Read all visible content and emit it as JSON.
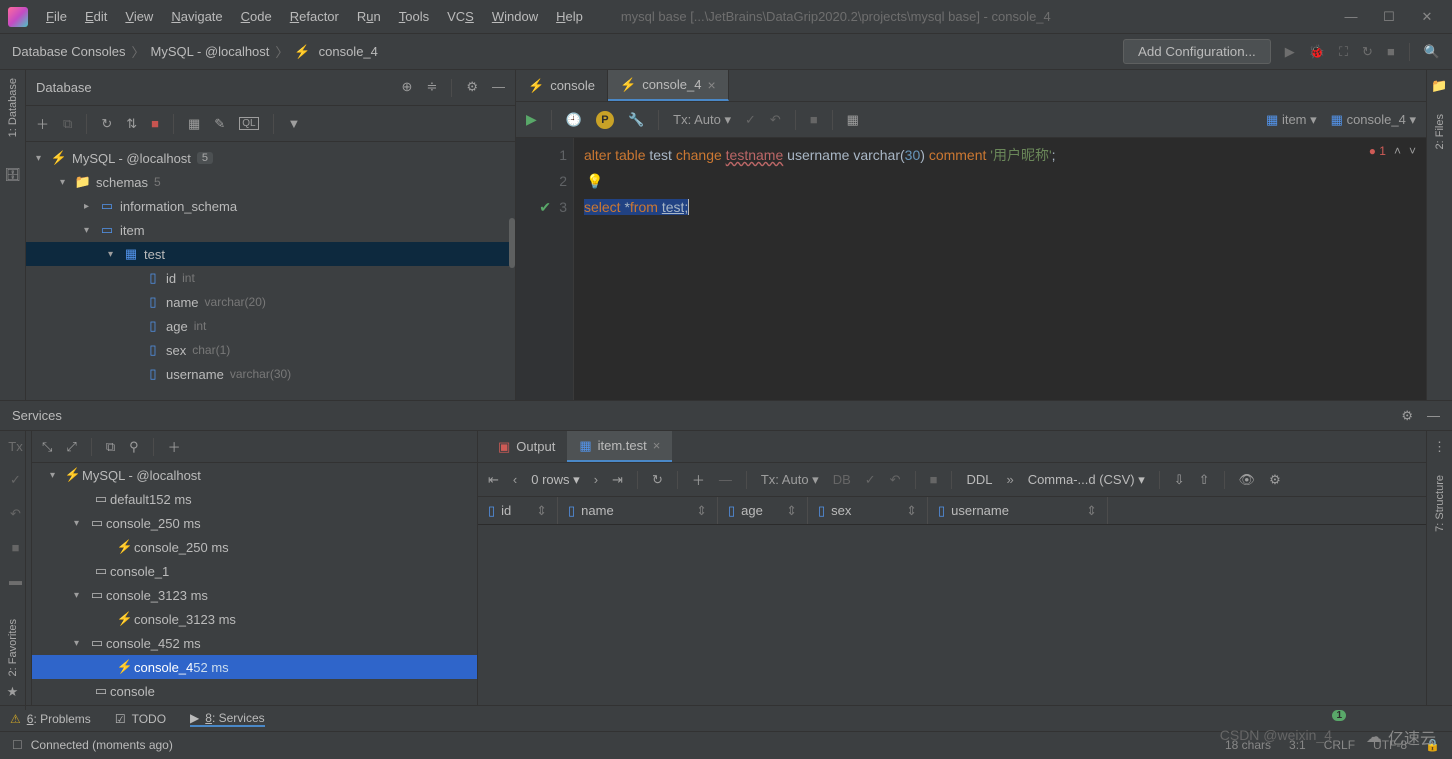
{
  "title_path": "mysql base [...\\JetBrains\\DataGrip2020.2\\projects\\mysql base] - console_4",
  "menu": [
    "File",
    "Edit",
    "View",
    "Navigate",
    "Code",
    "Refactor",
    "Run",
    "Tools",
    "VCS",
    "Window",
    "Help"
  ],
  "breadcrumb": {
    "b1": "Database Consoles",
    "b2": "MySQL - @localhost",
    "b3": "console_4"
  },
  "add_config": "Add Configuration...",
  "db_panel": {
    "title": "Database"
  },
  "tree": {
    "root": "MySQL - @localhost",
    "root_count": "5",
    "schemas": "schemas",
    "schemas_count": "5",
    "info_schema": "information_schema",
    "item": "item",
    "test": "test",
    "cols": {
      "id": {
        "name": "id",
        "type": "int"
      },
      "name": {
        "name": "name",
        "type": "varchar(20)"
      },
      "age": {
        "name": "age",
        "type": "int"
      },
      "sex": {
        "name": "sex",
        "type": "char(1)"
      },
      "username": {
        "name": "username",
        "type": "varchar(30)"
      }
    }
  },
  "tabs": {
    "t1": "console",
    "t2": "console_4"
  },
  "editor_toolbar": {
    "tx": "Tx: Auto",
    "item_sel": "item",
    "console_sel": "console_4"
  },
  "code": {
    "l1_kw1": "alter",
    "l1_kw2": "table",
    "l1_id1": "test",
    "l1_kw3": "change",
    "l1_idr": "testname",
    "l1_id2": "username",
    "l1_fn": "varchar",
    "l1_num": "30",
    "l1_kw4": "comment",
    "l1_str": "'用户昵称'",
    "l3_kw1": "select",
    "l3_star": "*",
    "l3_kw2": "from",
    "l3_id": "test"
  },
  "err_count": "1",
  "services": {
    "title": "Services",
    "root": "MySQL - @localhost",
    "default": {
      "name": "default",
      "time": "152 ms"
    },
    "c2": {
      "name": "console_2",
      "time": "50 ms"
    },
    "c2_child": {
      "name": "console_2",
      "time": "50 ms"
    },
    "c1": {
      "name": "console_1"
    },
    "c3": {
      "name": "console_3",
      "time": "123 ms"
    },
    "c3_child": {
      "name": "console_3",
      "time": "123 ms"
    },
    "c4": {
      "name": "console_4",
      "time": "52 ms"
    },
    "c4_child": {
      "name": "console_4",
      "time": "52 ms"
    },
    "c": {
      "name": "console"
    }
  },
  "svc_tabs": {
    "output": "Output",
    "itemtest": "item.test"
  },
  "result": {
    "rows": "0 rows",
    "tx": "Tx: Auto",
    "ddl": "DDL",
    "export": "Comma-...d (CSV)",
    "cols": {
      "id": "id",
      "name": "name",
      "age": "age",
      "sex": "sex",
      "username": "username"
    }
  },
  "bottom": {
    "problems": "6: Problems",
    "todo": "TODO",
    "services": "8: Services",
    "badge": "1"
  },
  "status": {
    "left": "Connected (moments ago)",
    "chars": "18 chars",
    "pos": "3:1",
    "crlf": "CRLF",
    "enc": "UTF-8"
  },
  "right_gutter": {
    "files": "2: Files",
    "structure": "7: Structure"
  },
  "left_gutter": {
    "database": "1: Database",
    "favorites": "2: Favorites"
  },
  "watermark": "亿速云",
  "watermark2": "CSDN @weixin_4"
}
